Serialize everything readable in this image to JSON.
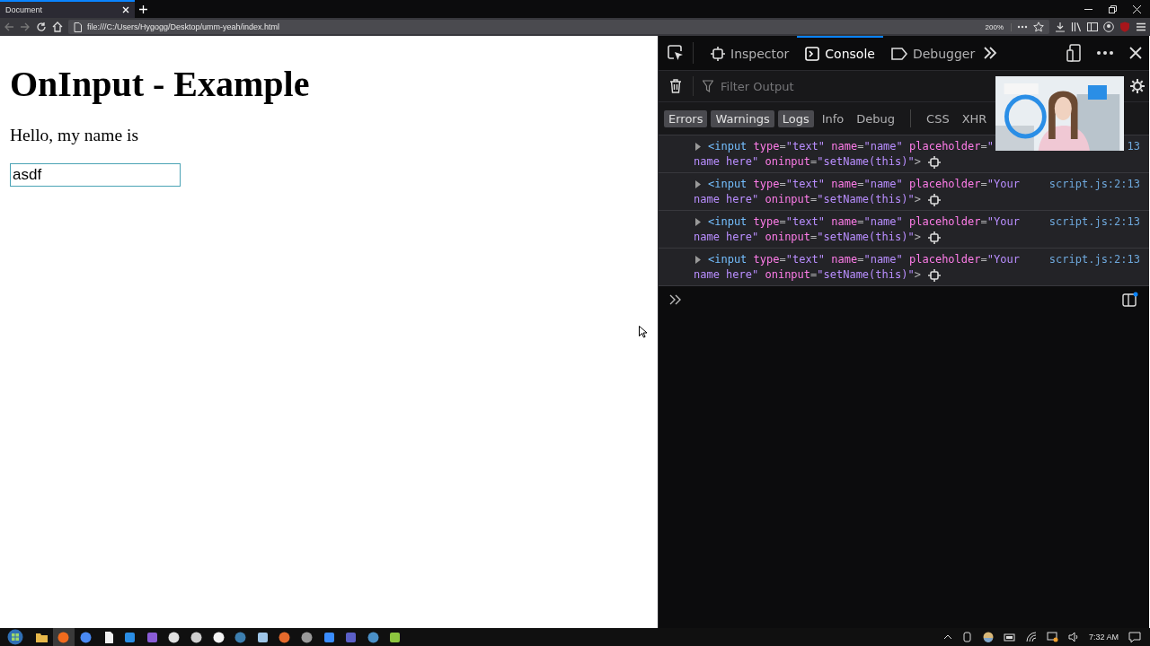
{
  "browser": {
    "tab": {
      "title": "Document"
    },
    "url": "file:///C:/Users/Hygogg/Desktop/umm-yeah/index.html",
    "zoom": "200%"
  },
  "page": {
    "heading": "OnInput - Example",
    "text": "Hello, my name is",
    "input": {
      "value": "asdf"
    }
  },
  "devtools": {
    "tabs": [
      {
        "label": "Inspector",
        "kind": "inspector",
        "selected": false
      },
      {
        "label": "Console",
        "kind": "console",
        "selected": true
      },
      {
        "label": "Debugger",
        "kind": "debugger",
        "selected": false
      }
    ],
    "filter": {
      "placeholder": "Filter Output"
    },
    "levels": [
      {
        "label": "Errors",
        "selected": true
      },
      {
        "label": "Warnings",
        "selected": true
      },
      {
        "label": "Logs",
        "selected": true
      },
      {
        "label": "Info",
        "selected": false
      },
      {
        "label": "Debug",
        "selected": false
      }
    ],
    "categories": [
      {
        "label": "CSS",
        "selected": false
      },
      {
        "label": "XHR",
        "selected": false
      }
    ],
    "messages": [
      {
        "location": "13",
        "lines": [
          [
            {
              "kind": "tag",
              "text": "<input"
            },
            {
              "kind": "attr",
              "text": "type"
            },
            {
              "kind": "punct",
              "text": "="
            },
            {
              "kind": "value",
              "text": "\"text\""
            },
            {
              "kind": "attr",
              "text": "name"
            },
            {
              "kind": "punct",
              "text": "="
            },
            {
              "kind": "value",
              "text": "\"name\""
            },
            {
              "kind": "attr",
              "text": "placeholder"
            },
            {
              "kind": "punct",
              "text": "="
            },
            {
              "kind": "value",
              "text": "\""
            }
          ],
          [
            {
              "kind": "value",
              "text": "name here\""
            },
            {
              "kind": "attr",
              "text": "oninput"
            },
            {
              "kind": "punct",
              "text": "="
            },
            {
              "kind": "value",
              "text": "\"setName(this)\""
            },
            {
              "kind": "punct",
              "text": ">"
            }
          ]
        ]
      },
      {
        "location": "script.js:2:13",
        "lines": [
          [
            {
              "kind": "tag",
              "text": "<input"
            },
            {
              "kind": "attr",
              "text": "type"
            },
            {
              "kind": "punct",
              "text": "="
            },
            {
              "kind": "value",
              "text": "\"text\""
            },
            {
              "kind": "attr",
              "text": "name"
            },
            {
              "kind": "punct",
              "text": "="
            },
            {
              "kind": "value",
              "text": "\"name\""
            },
            {
              "kind": "attr",
              "text": "placeholder"
            },
            {
              "kind": "punct",
              "text": "="
            },
            {
              "kind": "value",
              "text": "\"Your"
            }
          ],
          [
            {
              "kind": "value",
              "text": "name here\""
            },
            {
              "kind": "attr",
              "text": "oninput"
            },
            {
              "kind": "punct",
              "text": "="
            },
            {
              "kind": "value",
              "text": "\"setName(this)\""
            },
            {
              "kind": "punct",
              "text": ">"
            }
          ]
        ]
      },
      {
        "location": "script.js:2:13",
        "lines": [
          [
            {
              "kind": "tag",
              "text": "<input"
            },
            {
              "kind": "attr",
              "text": "type"
            },
            {
              "kind": "punct",
              "text": "="
            },
            {
              "kind": "value",
              "text": "\"text\""
            },
            {
              "kind": "attr",
              "text": "name"
            },
            {
              "kind": "punct",
              "text": "="
            },
            {
              "kind": "value",
              "text": "\"name\""
            },
            {
              "kind": "attr",
              "text": "placeholder"
            },
            {
              "kind": "punct",
              "text": "="
            },
            {
              "kind": "value",
              "text": "\"Your"
            }
          ],
          [
            {
              "kind": "value",
              "text": "name here\""
            },
            {
              "kind": "attr",
              "text": "oninput"
            },
            {
              "kind": "punct",
              "text": "="
            },
            {
              "kind": "value",
              "text": "\"setName(this)\""
            },
            {
              "kind": "punct",
              "text": ">"
            }
          ]
        ]
      },
      {
        "location": "script.js:2:13",
        "lines": [
          [
            {
              "kind": "tag",
              "text": "<input"
            },
            {
              "kind": "attr",
              "text": "type"
            },
            {
              "kind": "punct",
              "text": "="
            },
            {
              "kind": "value",
              "text": "\"text\""
            },
            {
              "kind": "attr",
              "text": "name"
            },
            {
              "kind": "punct",
              "text": "="
            },
            {
              "kind": "value",
              "text": "\"name\""
            },
            {
              "kind": "attr",
              "text": "placeholder"
            },
            {
              "kind": "punct",
              "text": "="
            },
            {
              "kind": "value",
              "text": "\"Your"
            }
          ],
          [
            {
              "kind": "value",
              "text": "name here\""
            },
            {
              "kind": "attr",
              "text": "oninput"
            },
            {
              "kind": "punct",
              "text": "="
            },
            {
              "kind": "value",
              "text": "\"setName(this)\""
            },
            {
              "kind": "punct",
              "text": ">"
            }
          ]
        ]
      }
    ]
  },
  "taskbar": {
    "apps": [
      {
        "kind": "folder",
        "color": "#e8b84a",
        "active": false
      },
      {
        "kind": "circle",
        "color": "#f26b1d",
        "active": true
      },
      {
        "kind": "circle",
        "color": "#4a8af4",
        "active": false
      },
      {
        "kind": "page",
        "color": "#f0f0f0",
        "active": false
      },
      {
        "kind": "square",
        "color": "#2a8ee6",
        "active": false
      },
      {
        "kind": "square",
        "color": "#8a5cd6",
        "active": false
      },
      {
        "kind": "circle",
        "color": "#e0e0e0",
        "active": false
      },
      {
        "kind": "circle",
        "color": "#cfcfcf",
        "active": false
      },
      {
        "kind": "circle",
        "color": "#f4f4f4",
        "active": false
      },
      {
        "kind": "circle",
        "color": "#3d7fb0",
        "active": false
      },
      {
        "kind": "square",
        "color": "#9fc6e8",
        "active": false
      },
      {
        "kind": "circle",
        "color": "#e56a2c",
        "active": false
      },
      {
        "kind": "circle",
        "color": "#9a9a9a",
        "active": false
      },
      {
        "kind": "square",
        "color": "#3a8dff",
        "active": false
      },
      {
        "kind": "square",
        "color": "#5b5fc7",
        "active": false
      },
      {
        "kind": "circle",
        "color": "#4a90c8",
        "active": false
      },
      {
        "kind": "square",
        "color": "#8dc63f",
        "active": false
      }
    ],
    "clock": "7:32 AM"
  }
}
